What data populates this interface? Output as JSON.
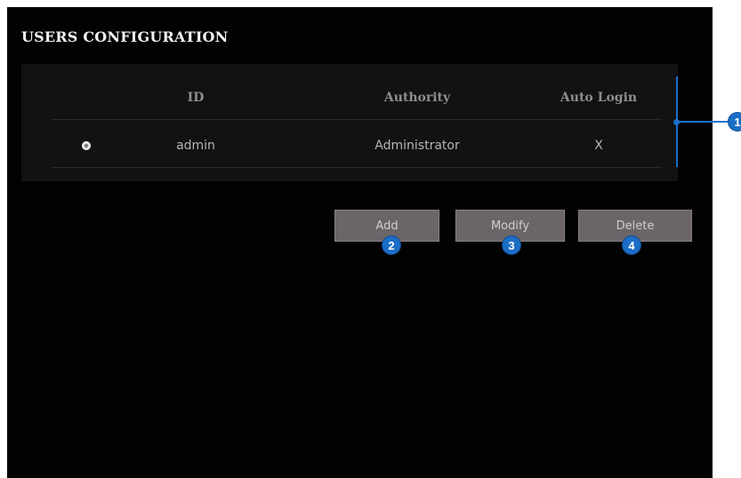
{
  "page": {
    "title": "USERS CONFIGURATION"
  },
  "users_table": {
    "columns": [
      "ID",
      "Authority",
      "Auto Login"
    ],
    "rows": [
      {
        "selected": true,
        "id": "admin",
        "authority": "Administrator",
        "auto_login": "X"
      }
    ]
  },
  "actions": {
    "add_label": "Add",
    "modify_label": "Modify",
    "delete_label": "Delete"
  },
  "callouts": [
    "1",
    "2",
    "3",
    "4"
  ],
  "colors": {
    "background": "#020202",
    "table_background": "#121212",
    "button_background": "#6b6469",
    "callout_blue": "#1b6ec5"
  },
  "icons": {
    "row_select": "radio-button-icon"
  }
}
